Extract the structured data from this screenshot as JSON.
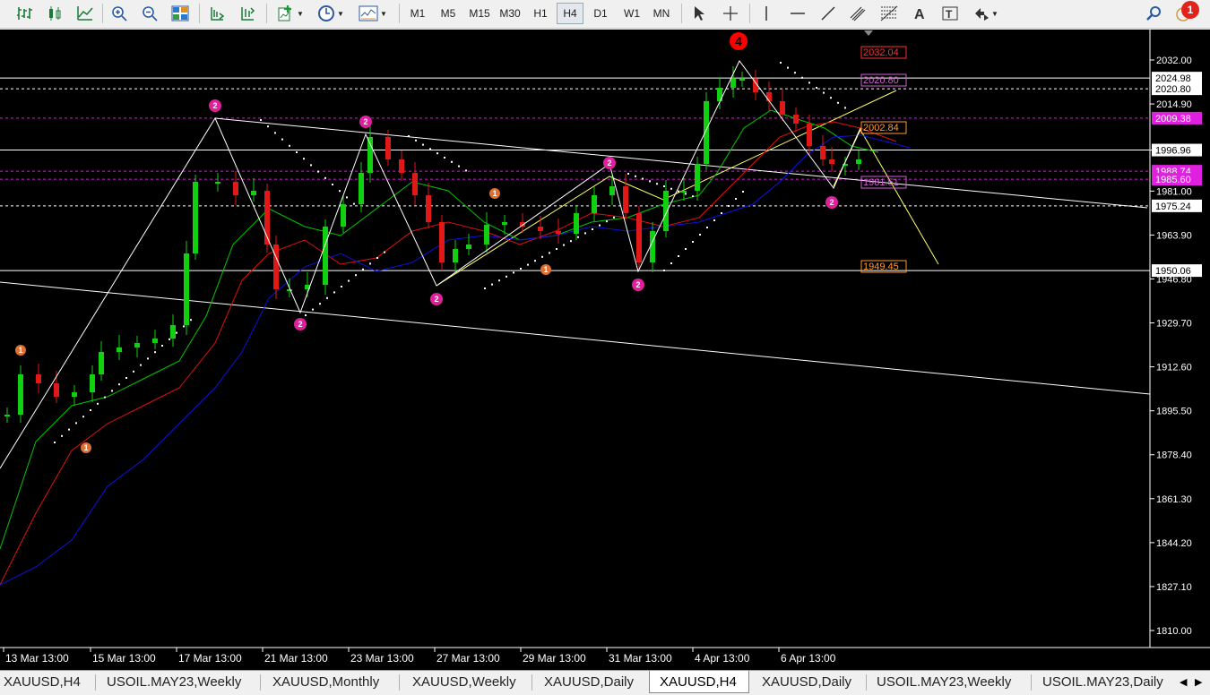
{
  "toolbar": {
    "timeframes": [
      "M1",
      "M5",
      "M15",
      "M30",
      "H1",
      "H4",
      "D1",
      "W1",
      "MN"
    ],
    "active_timeframe": "H4",
    "notification_count": "1"
  },
  "chart": {
    "symbol": "XAUUSD",
    "timeframe": "H4",
    "background": "#000000",
    "colors": {
      "bull": "#10d010",
      "bear": "#e01818",
      "ma_fast": "#00c800",
      "ma_mid": "#e01010",
      "ma_slow": "#1010e0",
      "zigzag": "#ffffff",
      "trendline": "#ffff66"
    },
    "price_axis": [
      "2032.00",
      "2014.90",
      "1996.96",
      "1981.00",
      "1963.90",
      "1946.80",
      "1929.70",
      "1912.60",
      "1895.50",
      "1878.40",
      "1861.30",
      "1844.20",
      "1827.10",
      "1810.00"
    ],
    "price_tags": [
      {
        "value": "2024.98",
        "style": "plain"
      },
      {
        "value": "2020.80",
        "style": "plain"
      },
      {
        "value": "2009.38",
        "style": "magenta"
      },
      {
        "value": "1996.96",
        "style": "plain"
      },
      {
        "value": "1988.74",
        "style": "magenta"
      },
      {
        "value": "1985.60",
        "style": "magenta"
      },
      {
        "value": "1975.24",
        "style": "plain"
      },
      {
        "value": "1950.06",
        "style": "plain"
      }
    ],
    "inline_labels": [
      {
        "text": "2032.04",
        "color": "#ff3030"
      },
      {
        "text": "2020.80",
        "color": "#d060d0"
      },
      {
        "text": "2002.84",
        "color": "#ff9a30"
      },
      {
        "text": "1981.51",
        "color": "#d060d0"
      },
      {
        "text": "1949.45",
        "color": "#ff9a30"
      }
    ],
    "time_axis": [
      "13 Mar 13:00",
      "15 Mar 13:00",
      "17 Mar 13:00",
      "21 Mar 13:00",
      "23 Mar 13:00",
      "27 Mar 13:00",
      "29 Mar 13:00",
      "31 Mar 13:00",
      "4 Apr 13:00",
      "6 Apr 13:00"
    ],
    "markers": [
      {
        "label": "1",
        "color": "#e07030"
      },
      {
        "label": "1",
        "color": "#e07030"
      },
      {
        "label": "2",
        "color": "#e0209a"
      },
      {
        "label": "2",
        "color": "#e0209a"
      },
      {
        "label": "2",
        "color": "#e0209a"
      },
      {
        "label": "2",
        "color": "#e0209a"
      },
      {
        "label": "1",
        "color": "#e07030"
      },
      {
        "label": "1",
        "color": "#e07030"
      },
      {
        "label": "2",
        "color": "#e0209a"
      },
      {
        "label": "2",
        "color": "#e0209a"
      },
      {
        "label": "4",
        "color": "#ff0000"
      },
      {
        "label": "2",
        "color": "#e0209a"
      }
    ]
  },
  "tabs": [
    {
      "label": "XAUUSD,H4",
      "active": false
    },
    {
      "label": "USOIL.MAY23,Weekly",
      "active": false
    },
    {
      "label": "XAUUSD,Monthly",
      "active": false
    },
    {
      "label": "XAUUSD,Weekly",
      "active": false
    },
    {
      "label": "XAUUSD,Daily",
      "active": false
    },
    {
      "label": "XAUUSD,H4",
      "active": true
    },
    {
      "label": "XAUUSD,Daily",
      "active": false
    },
    {
      "label": "USOIL.MAY23,Weekly",
      "active": false
    },
    {
      "label": "USOIL.MAY23,Daily",
      "active": false
    }
  ]
}
